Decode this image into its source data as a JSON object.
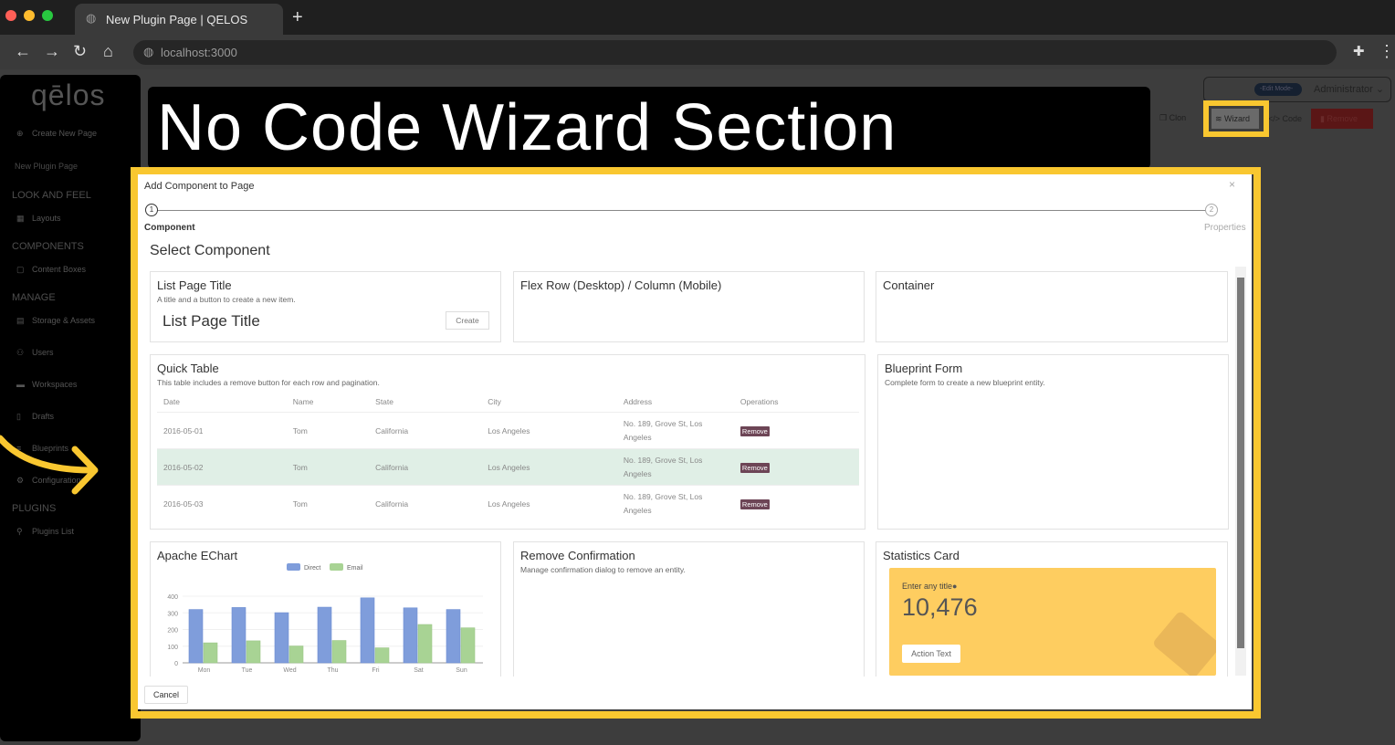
{
  "browser": {
    "tab_title": "New Plugin Page | QELOS",
    "url": "localhost:3000"
  },
  "sidebar": {
    "logo": "qēlos",
    "create": "Create New Page",
    "current_page": "New Plugin Page",
    "sections": [
      {
        "title": "LOOK AND FEEL",
        "items": [
          {
            "label": "Layouts",
            "icon": "grid-icon"
          }
        ]
      },
      {
        "title": "COMPONENTS",
        "items": [
          {
            "label": "Content Boxes",
            "icon": "box-icon"
          }
        ]
      },
      {
        "title": "MANAGE",
        "items": [
          {
            "label": "Storage & Assets",
            "icon": "storage-icon"
          },
          {
            "label": "Users",
            "icon": "users-icon"
          },
          {
            "label": "Workspaces",
            "icon": "briefcase-icon"
          },
          {
            "label": "Drafts",
            "icon": "document-icon"
          },
          {
            "label": "Blueprints",
            "icon": "database-icon"
          },
          {
            "label": "Configurations",
            "icon": "gear-icon"
          }
        ]
      },
      {
        "title": "PLUGINS",
        "items": [
          {
            "label": "Plugins List",
            "icon": "plugin-icon"
          }
        ]
      }
    ]
  },
  "topbar": {
    "edit_mode": "-Edit Mode-",
    "user": "Administrator",
    "clone": "Clon",
    "wizard": "Wizard",
    "code": "</> Code",
    "remove": "Remove"
  },
  "banner": "No Code Wizard Section",
  "dialog": {
    "title": "Add Component to Page",
    "step1_num": "1",
    "step1": "Component",
    "step2_num": "2",
    "step2": "Properties",
    "heading": "Select Component",
    "cancel": "Cancel"
  },
  "cards": {
    "list_title": {
      "title": "List Page Title",
      "desc": "A title and a button to create a new item.",
      "preview": "List Page Title",
      "button": "Create"
    },
    "flex": {
      "title": "Flex Row (Desktop) / Column (Mobile)"
    },
    "container": {
      "title": "Container"
    },
    "quick_table": {
      "title": "Quick Table",
      "desc": "This table includes a remove button for each row and pagination.",
      "columns": [
        "Date",
        "Name",
        "State",
        "City",
        "Address",
        "Operations"
      ],
      "rows": [
        [
          "2016-05-01",
          "Tom",
          "California",
          "Los Angeles",
          "No. 189, Grove St, Los Angeles",
          "Remove"
        ],
        [
          "2016-05-02",
          "Tom",
          "California",
          "Los Angeles",
          "No. 189, Grove St, Los Angeles",
          "Remove"
        ],
        [
          "2016-05-03",
          "Tom",
          "California",
          "Los Angeles",
          "No. 189, Grove St, Los Angeles",
          "Remove"
        ]
      ]
    },
    "blueprint": {
      "title": "Blueprint Form",
      "desc": "Complete form to create a new blueprint entity."
    },
    "echart": {
      "title": "Apache EChart"
    },
    "remove_conf": {
      "title": "Remove Confirmation",
      "desc": "Manage confirmation dialog to remove an entity."
    },
    "stats": {
      "title": "Statistics Card",
      "label": "Enter any title",
      "value": "10,476",
      "action": "Action Text",
      "color": "#fecd60"
    }
  },
  "chart_data": {
    "type": "bar",
    "categories": [
      "Mon",
      "Tue",
      "Wed",
      "Thu",
      "Fri",
      "Sat",
      "Sun"
    ],
    "series": [
      {
        "name": "Direct",
        "values": [
          320,
          332,
          301,
          334,
          390,
          330,
          320
        ],
        "color": "#7f9ddb"
      },
      {
        "name": "Email",
        "values": [
          120,
          132,
          101,
          134,
          90,
          230,
          210
        ],
        "color": "#a8d394"
      }
    ],
    "yticks": [
      "0",
      "100",
      "200",
      "300",
      "400"
    ],
    "ylim": [
      0,
      400
    ],
    "legend": "top"
  }
}
